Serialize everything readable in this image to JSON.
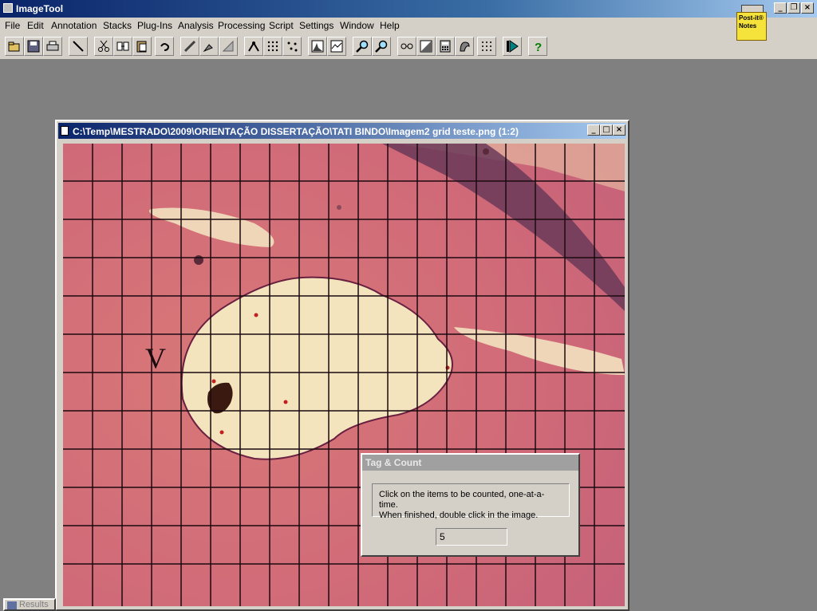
{
  "app": {
    "title": "ImageTool"
  },
  "menu": [
    "File",
    "Edit",
    "Annotation",
    "Stacks",
    "Plug-Ins",
    "Analysis",
    "Processing",
    "Script",
    "Settings",
    "Window",
    "Help"
  ],
  "toolbar_icons": [
    "open-icon",
    "save-icon",
    "print-icon",
    "line-icon",
    "cut-icon",
    "copy-icon",
    "paste-icon",
    "undo-icon",
    "pencil-icon",
    "brush-icon",
    "eraser-icon",
    "tool-a-icon",
    "tool-b-icon",
    "tool-c-icon",
    "histogram-icon",
    "profile-icon",
    "zoom-in-icon",
    "zoom-out-icon",
    "tool-d-icon",
    "contrast-icon",
    "calculator-icon",
    "tool-e-icon",
    "grid-icon",
    "play-icon",
    "help-icon"
  ],
  "postit": {
    "label": "Post-it® Notes"
  },
  "document": {
    "title": "C:\\Temp\\MESTRADO\\2009\\ORIENTAÇÃO DISSERTAÇÃO\\TATI BINDO\\Imagem2 grid teste.png (1:2)",
    "letter": "V"
  },
  "dialog": {
    "title": "Tag & Count",
    "instructions_line1": "Click on the items to be counted, one-at-a-time.",
    "instructions_line2": "When finished, double click in the image.",
    "count": "5"
  },
  "results": {
    "label": "Results"
  }
}
